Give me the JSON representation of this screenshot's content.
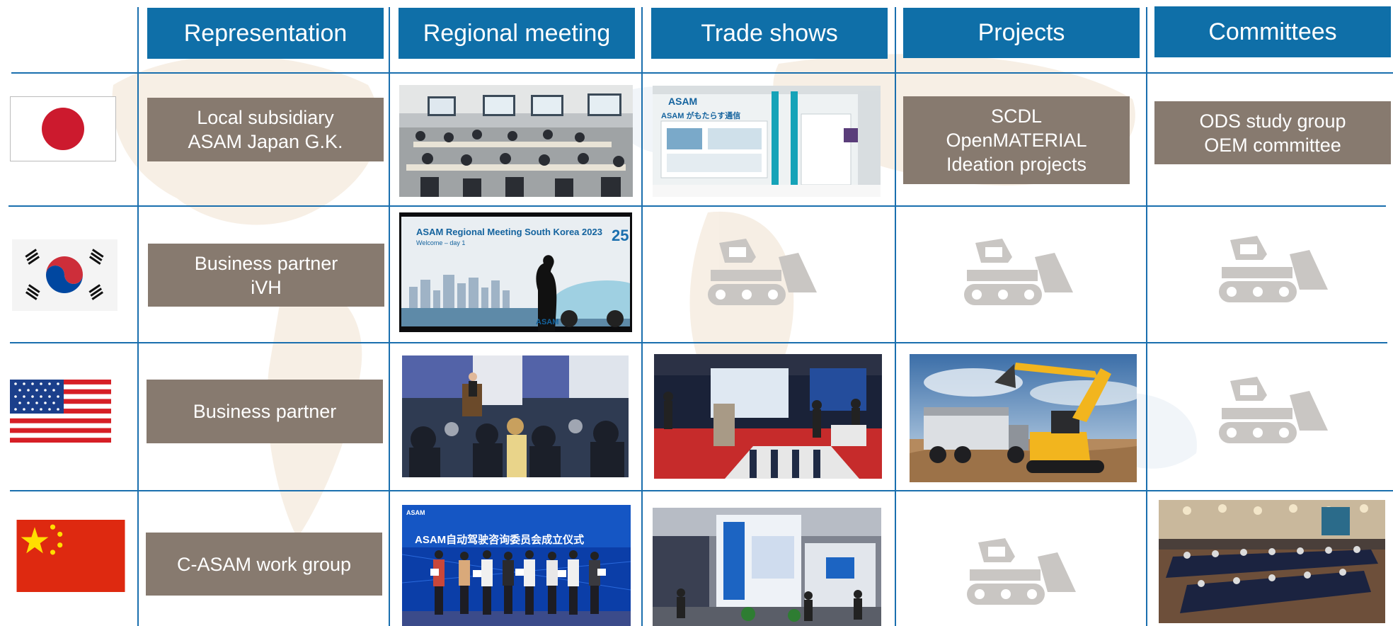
{
  "headers": [
    "Representation",
    "Regional meeting",
    "Trade shows",
    "Projects",
    "Committees"
  ],
  "rows": [
    {
      "country_flag": "japan-flag",
      "representation": [
        "Local subsidiary",
        "ASAM Japan G.K."
      ],
      "projects": [
        "SCDL",
        "OpenMATERIAL",
        "Ideation projects"
      ],
      "committees": [
        "ODS study group",
        "OEM committee"
      ]
    },
    {
      "country_flag": "south-korea-flag",
      "representation": [
        "Business partner",
        "iVH"
      ],
      "regional_meeting_banner": {
        "title": "ASAM Regional Meeting South Korea 2023",
        "subtitle": "Welcome – day 1",
        "logo": "ASAM"
      }
    },
    {
      "country_flag": "usa-flag",
      "representation": [
        "Business partner"
      ]
    },
    {
      "country_flag": "china-flag",
      "representation": [
        "C-ASAM work group"
      ],
      "regional_meeting_banner": {
        "title": "ASAM自动驾驶咨询委员会成立仪式",
        "logo": "ASAM"
      }
    }
  ],
  "trade_show_japan": {
    "logo": "ASAM",
    "tagline": "ASAM がもたらす通信"
  },
  "placeholder_icon": "bulldozer-placeholder-icon",
  "colors": {
    "header_bg": "#0f6fa8",
    "box_bg": "#877a6f",
    "grid_line": "#1a6fae",
    "placeholder": "#c9c6c3"
  }
}
